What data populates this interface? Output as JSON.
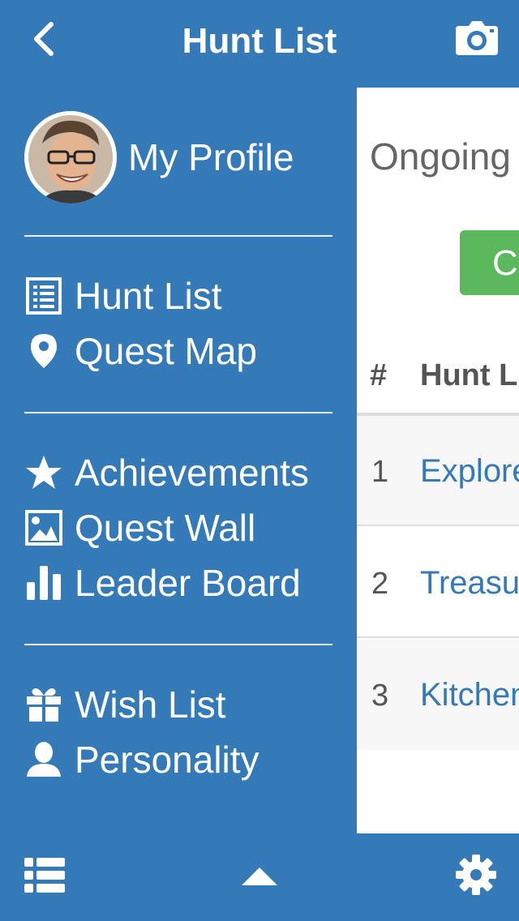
{
  "header": {
    "title": "Hunt List"
  },
  "sidebar": {
    "profile_label": "My Profile",
    "items": [
      {
        "label": "Hunt List",
        "icon": "list-icon"
      },
      {
        "label": "Quest Map",
        "icon": "map-pin-icon"
      },
      {
        "label": "Achievements",
        "icon": "star-icon"
      },
      {
        "label": "Quest Wall",
        "icon": "picture-icon"
      },
      {
        "label": "Leader Board",
        "icon": "bar-chart-icon"
      },
      {
        "label": "Wish List",
        "icon": "gift-icon"
      },
      {
        "label": "Personality",
        "icon": "user-icon"
      }
    ]
  },
  "main": {
    "section_title": "Ongoing",
    "button_label": "C",
    "table": {
      "headers": [
        "#",
        "Hunt L"
      ],
      "rows": [
        {
          "num": "1",
          "name": "Explore"
        },
        {
          "num": "2",
          "name": "Treasur"
        },
        {
          "num": "3",
          "name": "Kitchen"
        }
      ]
    }
  },
  "colors": {
    "primary": "#3479b8",
    "success": "#5cb85c",
    "white": "#ffffff"
  }
}
